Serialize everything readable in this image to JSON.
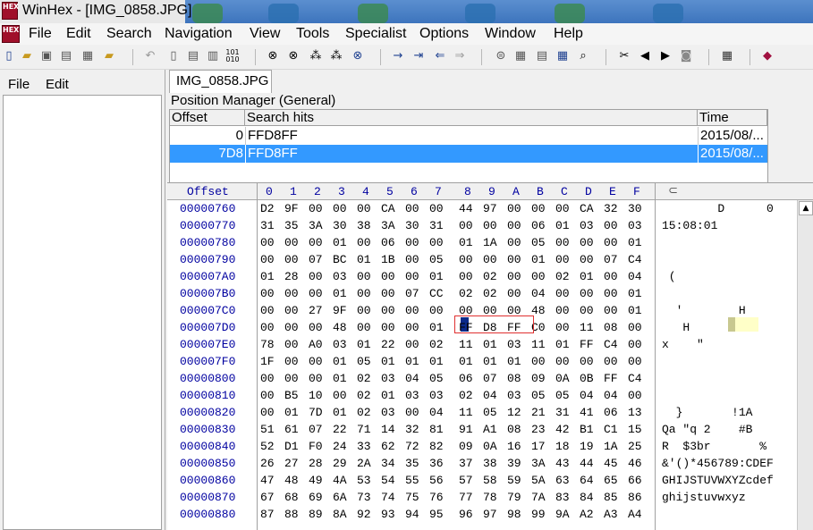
{
  "window": {
    "title": "WinHex - [IMG_0858.JPG]",
    "app_icon_text": "HEX"
  },
  "menubar": {
    "items": [
      "File",
      "Edit",
      "Search",
      "Navigation",
      "View",
      "Tools",
      "Specialist",
      "Options",
      "Window",
      "Help"
    ]
  },
  "toolbar": {
    "icons": [
      "new-file-icon",
      "open-folder-icon",
      "save-icon",
      "print-icon",
      "properties-icon",
      "open-disk-icon",
      "undo-icon",
      "copy-icon",
      "paste-icon",
      "paste-special-icon",
      "binary-icon",
      "find-icon",
      "find-hex-icon",
      "replace-icon",
      "replace-hex-icon",
      "find-next-icon",
      "goto-offset-icon",
      "goto-icon",
      "back-icon",
      "forward-icon",
      "disk-icon",
      "ram-icon",
      "disk-image-icon",
      "calculator-icon",
      "magnify-icon",
      "clipboard-icon",
      "prev-icon",
      "next-icon",
      "camera-icon",
      "table-icon",
      "book-icon"
    ]
  },
  "leftpane": {
    "menu": [
      "File",
      "Edit"
    ]
  },
  "document": {
    "tab_label": "IMG_0858.JPG"
  },
  "position_manager": {
    "title": "Position Manager (General)",
    "columns": [
      "Offset",
      "Search hits",
      "Time"
    ],
    "rows": [
      {
        "offset": "0",
        "hit": "FFD8FF",
        "time": "2015/08/..."
      },
      {
        "offset": "7D8",
        "hit": "FFD8FF",
        "time": "2015/08/..."
      }
    ],
    "selected_row": 1
  },
  "hex": {
    "header_offset": "Offset",
    "header_cols": [
      "0",
      "1",
      "2",
      "3",
      "4",
      "5",
      "6",
      "7",
      "8",
      "9",
      "A",
      "B",
      "C",
      "D",
      "E",
      "F"
    ],
    "rows": [
      {
        "offset": "00000760",
        "bytes": [
          "D2",
          "9F",
          "00",
          "00",
          "00",
          "CA",
          "00",
          "00",
          "44",
          "97",
          "00",
          "00",
          "00",
          "CA",
          "32",
          "30"
        ],
        "text": "        D      0"
      },
      {
        "offset": "00000770",
        "bytes": [
          "31",
          "35",
          "3A",
          "30",
          "38",
          "3A",
          "30",
          "31",
          "00",
          "00",
          "00",
          "06",
          "01",
          "03",
          "00",
          "03"
        ],
        "text": "15:08:01"
      },
      {
        "offset": "00000780",
        "bytes": [
          "00",
          "00",
          "00",
          "01",
          "00",
          "06",
          "00",
          "00",
          "01",
          "1A",
          "00",
          "05",
          "00",
          "00",
          "00",
          "01"
        ],
        "text": ""
      },
      {
        "offset": "00000790",
        "bytes": [
          "00",
          "00",
          "07",
          "BC",
          "01",
          "1B",
          "00",
          "05",
          "00",
          "00",
          "00",
          "01",
          "00",
          "00",
          "07",
          "C4"
        ],
        "text": ""
      },
      {
        "offset": "000007A0",
        "bytes": [
          "01",
          "28",
          "00",
          "03",
          "00",
          "00",
          "00",
          "01",
          "00",
          "02",
          "00",
          "00",
          "02",
          "01",
          "00",
          "04"
        ],
        "text": " ("
      },
      {
        "offset": "000007B0",
        "bytes": [
          "00",
          "00",
          "00",
          "01",
          "00",
          "00",
          "07",
          "CC",
          "02",
          "02",
          "00",
          "04",
          "00",
          "00",
          "00",
          "01"
        ],
        "text": ""
      },
      {
        "offset": "000007C0",
        "bytes": [
          "00",
          "00",
          "27",
          "9F",
          "00",
          "00",
          "00",
          "00",
          "00",
          "00",
          "00",
          "48",
          "00",
          "00",
          "00",
          "01"
        ],
        "text": "  '        H"
      },
      {
        "offset": "000007D0",
        "bytes": [
          "00",
          "00",
          "00",
          "48",
          "00",
          "00",
          "00",
          "01",
          "FF",
          "D8",
          "FF",
          "C0",
          "00",
          "11",
          "08",
          "00"
        ],
        "text": "   H"
      },
      {
        "offset": "000007E0",
        "bytes": [
          "78",
          "00",
          "A0",
          "03",
          "01",
          "22",
          "00",
          "02",
          "11",
          "01",
          "03",
          "11",
          "01",
          "FF",
          "C4",
          "00"
        ],
        "text": "x    \""
      },
      {
        "offset": "000007F0",
        "bytes": [
          "1F",
          "00",
          "00",
          "01",
          "05",
          "01",
          "01",
          "01",
          "01",
          "01",
          "01",
          "00",
          "00",
          "00",
          "00",
          "00"
        ],
        "text": ""
      },
      {
        "offset": "00000800",
        "bytes": [
          "00",
          "00",
          "00",
          "01",
          "02",
          "03",
          "04",
          "05",
          "06",
          "07",
          "08",
          "09",
          "0A",
          "0B",
          "FF",
          "C4"
        ],
        "text": ""
      },
      {
        "offset": "00000810",
        "bytes": [
          "00",
          "B5",
          "10",
          "00",
          "02",
          "01",
          "03",
          "03",
          "02",
          "04",
          "03",
          "05",
          "05",
          "04",
          "04",
          "00"
        ],
        "text": ""
      },
      {
        "offset": "00000820",
        "bytes": [
          "00",
          "01",
          "7D",
          "01",
          "02",
          "03",
          "00",
          "04",
          "11",
          "05",
          "12",
          "21",
          "31",
          "41",
          "06",
          "13"
        ],
        "text": "  }       !1A"
      },
      {
        "offset": "00000830",
        "bytes": [
          "51",
          "61",
          "07",
          "22",
          "71",
          "14",
          "32",
          "81",
          "91",
          "A1",
          "08",
          "23",
          "42",
          "B1",
          "C1",
          "15"
        ],
        "text": "Qa \"q 2    #B"
      },
      {
        "offset": "00000840",
        "bytes": [
          "52",
          "D1",
          "F0",
          "24",
          "33",
          "62",
          "72",
          "82",
          "09",
          "0A",
          "16",
          "17",
          "18",
          "19",
          "1A",
          "25"
        ],
        "text": "R  $3br       %"
      },
      {
        "offset": "00000850",
        "bytes": [
          "26",
          "27",
          "28",
          "29",
          "2A",
          "34",
          "35",
          "36",
          "37",
          "38",
          "39",
          "3A",
          "43",
          "44",
          "45",
          "46"
        ],
        "text": "&'()*456789:CDEF"
      },
      {
        "offset": "00000860",
        "bytes": [
          "47",
          "48",
          "49",
          "4A",
          "53",
          "54",
          "55",
          "56",
          "57",
          "58",
          "59",
          "5A",
          "63",
          "64",
          "65",
          "66"
        ],
        "text": "GHIJSTUVWXYZcdef"
      },
      {
        "offset": "00000870",
        "bytes": [
          "67",
          "68",
          "69",
          "6A",
          "73",
          "74",
          "75",
          "76",
          "77",
          "78",
          "79",
          "7A",
          "83",
          "84",
          "85",
          "86"
        ],
        "text": "ghijstuvwxyz"
      },
      {
        "offset": "00000880",
        "bytes": [
          "87",
          "88",
          "89",
          "8A",
          "92",
          "93",
          "94",
          "95",
          "96",
          "97",
          "98",
          "99",
          "9A",
          "A2",
          "A3",
          "A4"
        ],
        "text": ""
      }
    ]
  },
  "colors": {
    "selection": "#3399ff",
    "offset_text": "#0000a0",
    "highlight_box": "#e03030"
  }
}
